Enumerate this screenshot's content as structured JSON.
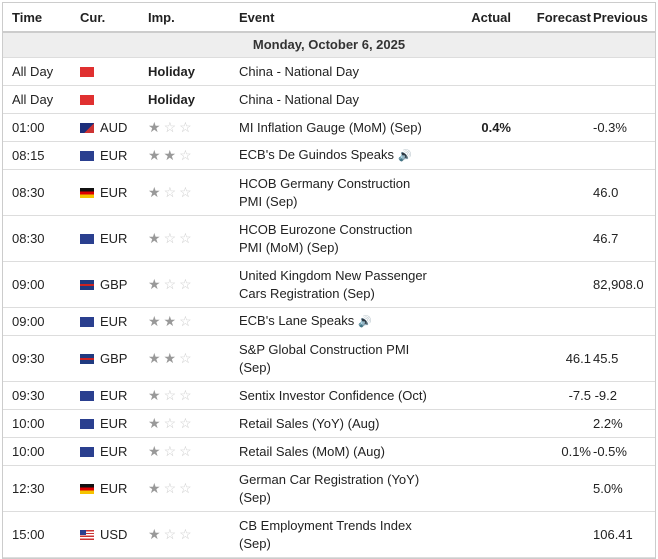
{
  "headers": {
    "time": "Time",
    "cur": "Cur.",
    "imp": "Imp.",
    "event": "Event",
    "actual": "Actual",
    "forecast": "Forecast",
    "previous": "Previous"
  },
  "date": "Monday, October 6, 2025",
  "rows": [
    {
      "time": "All Day",
      "flag": "cn",
      "cur": "",
      "imp": "Holiday",
      "stars": 0,
      "event": "China - National Day",
      "actual": "",
      "forecast": "",
      "previous": ""
    },
    {
      "time": "All Day",
      "flag": "cn",
      "cur": "",
      "imp": "Holiday",
      "stars": 0,
      "event": "China - National Day",
      "actual": "",
      "forecast": "",
      "previous": ""
    },
    {
      "time": "01:00",
      "flag": "au",
      "cur": "AUD",
      "stars": 1,
      "event": "MI Inflation Gauge (MoM) (Sep)",
      "actual": "0.4%",
      "forecast": "",
      "previous": "-0.3%"
    },
    {
      "time": "08:15",
      "flag": "eu",
      "cur": "EUR",
      "stars": 2,
      "event": "ECB's De Guindos Speaks",
      "speech": true,
      "actual": "",
      "forecast": "",
      "previous": ""
    },
    {
      "time": "08:30",
      "flag": "de",
      "cur": "EUR",
      "stars": 1,
      "event": "HCOB Germany Construction PMI (Sep)",
      "actual": "",
      "forecast": "",
      "previous": "46.0",
      "tall": true
    },
    {
      "time": "08:30",
      "flag": "eu",
      "cur": "EUR",
      "stars": 1,
      "event": "HCOB Eurozone Construction PMI (MoM) (Sep)",
      "actual": "",
      "forecast": "",
      "previous": "46.7",
      "tall": true
    },
    {
      "time": "09:00",
      "flag": "gb",
      "cur": "GBP",
      "stars": 1,
      "event": "United Kingdom New Passenger Cars Registration (Sep)",
      "actual": "",
      "forecast": "",
      "previous": "82,908.0",
      "tall": true
    },
    {
      "time": "09:00",
      "flag": "eu",
      "cur": "EUR",
      "stars": 2,
      "event": "ECB's Lane Speaks",
      "speech": true,
      "actual": "",
      "forecast": "",
      "previous": ""
    },
    {
      "time": "09:30",
      "flag": "gb",
      "cur": "GBP",
      "stars": 2,
      "event": "S&P Global Construction PMI (Sep)",
      "actual": "",
      "forecast": "46.1",
      "previous": "45.5",
      "tall": true
    },
    {
      "time": "09:30",
      "flag": "eu",
      "cur": "EUR",
      "stars": 1,
      "event": "Sentix Investor Confidence (Oct)",
      "actual": "",
      "forecast": "-7.5",
      "previous": "-9.2"
    },
    {
      "time": "10:00",
      "flag": "eu",
      "cur": "EUR",
      "stars": 1,
      "event": "Retail Sales (YoY) (Aug)",
      "actual": "",
      "forecast": "",
      "previous": "2.2%"
    },
    {
      "time": "10:00",
      "flag": "eu",
      "cur": "EUR",
      "stars": 1,
      "event": "Retail Sales (MoM) (Aug)",
      "actual": "",
      "forecast": "0.1%",
      "previous": "-0.5%"
    },
    {
      "time": "12:30",
      "flag": "de",
      "cur": "EUR",
      "stars": 1,
      "event": "German Car Registration (YoY) (Sep)",
      "actual": "",
      "forecast": "",
      "previous": "5.0%",
      "tall": true
    },
    {
      "time": "15:00",
      "flag": "us",
      "cur": "USD",
      "stars": 1,
      "event": "CB Employment Trends Index (Sep)",
      "actual": "",
      "forecast": "",
      "previous": "106.41",
      "tall": true
    }
  ]
}
